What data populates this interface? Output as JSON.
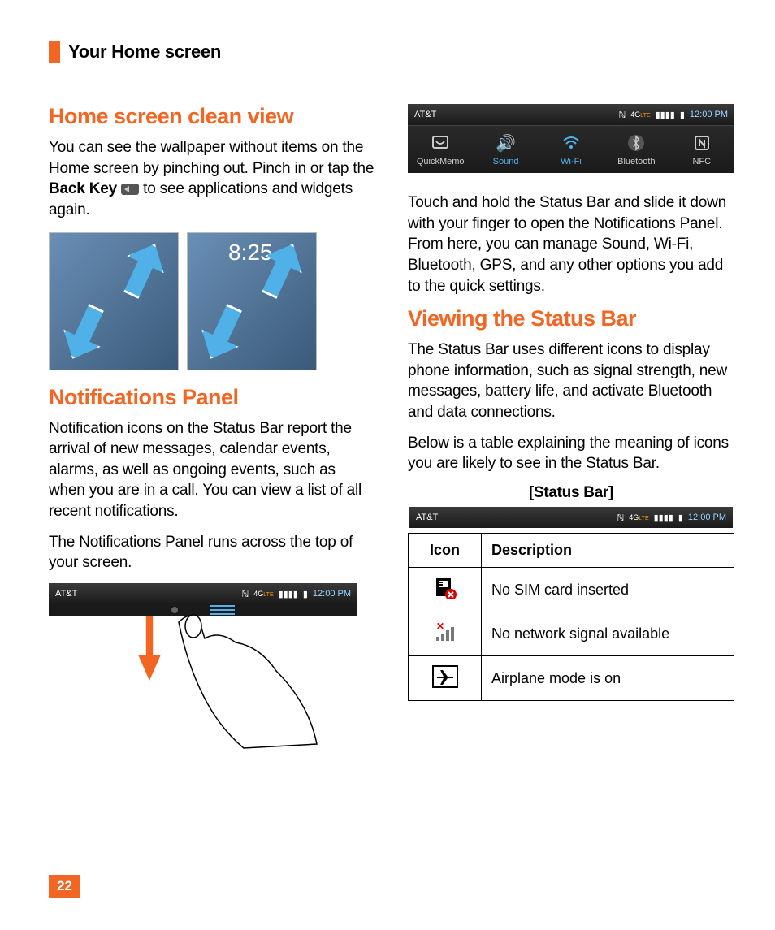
{
  "header": {
    "title": "Your Home screen"
  },
  "page_number": "22",
  "left": {
    "h1": "Home screen clean view",
    "p1a": "You can see the wallpaper without items on the Home screen by pinching out. Pinch in or tap the ",
    "p1b_bold": "Back Key",
    "p1c": " to see applications and widgets again.",
    "shot2_clock": "8:25",
    "h2": "Notifications Panel",
    "p2": "Notification icons on the Status Bar report the arrival of new messages, calendar events, alarms, as well as ongoing events, such as when you are in a call. You can view a list of all recent notifications.",
    "p3": "The Notifications Panel runs across the top of your screen.",
    "statusbar": {
      "carrier": "AT&T",
      "time": "12:00 PM"
    }
  },
  "right": {
    "statusbar": {
      "carrier": "AT&T",
      "time": "12:00 PM"
    },
    "quick": [
      {
        "label": "QuickMemo",
        "style": "white"
      },
      {
        "label": "Sound",
        "style": "blue"
      },
      {
        "label": "Wi-Fi",
        "style": "blue"
      },
      {
        "label": "Bluetooth",
        "style": "white"
      },
      {
        "label": "NFC",
        "style": "white"
      }
    ],
    "p1": "Touch and hold the Status Bar and slide it down with your finger to open the Notifications Panel. From here, you can manage Sound, Wi-Fi, Bluetooth, GPS, and any other options you add to the quick settings.",
    "h1": "Viewing the Status Bar",
    "p2": "The Status Bar uses different icons to display phone information, such as signal strength, new messages, battery life, and activate Bluetooth and data connections.",
    "p3": "Below is a table explaining the meaning of icons you are likely to see in the Status Bar.",
    "table_caption": "[Status Bar]",
    "table_statusbar": {
      "carrier": "AT&T",
      "time": "12:00 PM"
    },
    "table": {
      "head": {
        "icon": "Icon",
        "desc": "Description"
      },
      "rows": [
        {
          "desc": "No SIM card inserted"
        },
        {
          "desc": "No network signal available"
        },
        {
          "desc": "Airplane mode is on"
        }
      ]
    }
  }
}
